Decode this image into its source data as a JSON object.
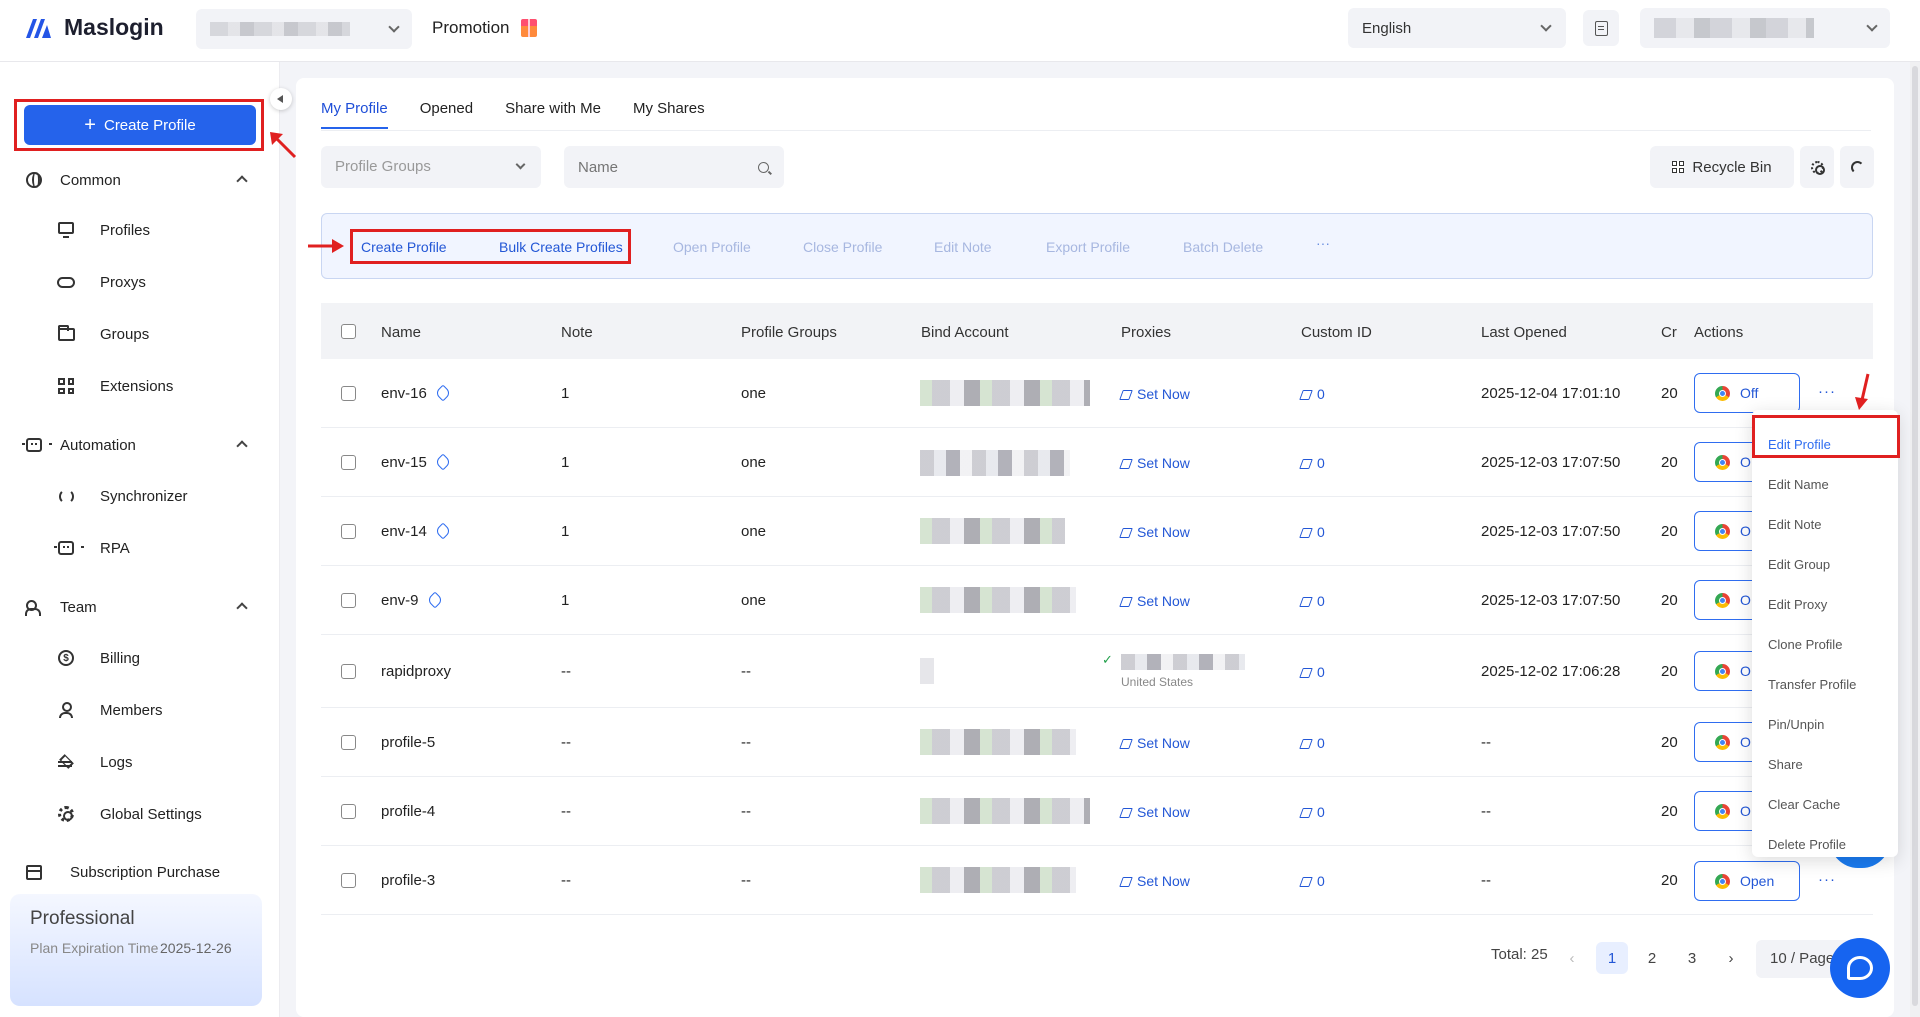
{
  "app": {
    "name": "Maslogin",
    "promotion": "Promotion",
    "language": "English"
  },
  "sidebar": {
    "create_profile": "Create Profile",
    "sections": [
      {
        "label": "Common",
        "items": [
          "Profiles",
          "Proxys",
          "Groups",
          "Extensions"
        ]
      },
      {
        "label": "Automation",
        "items": [
          "Synchronizer",
          "RPA"
        ]
      },
      {
        "label": "Team",
        "items": [
          "Billing",
          "Members",
          "Logs",
          "Global Settings"
        ]
      }
    ],
    "subscription": "Subscription Purchase",
    "plan": {
      "title": "Professional",
      "expiration_label": "Plan Expiration Time",
      "expiration_value": "2025-12-26"
    }
  },
  "tabs": [
    "My Profile",
    "Opened",
    "Share with Me",
    "My Shares"
  ],
  "filters": {
    "groups_placeholder": "Profile Groups",
    "name_placeholder": "Name",
    "recycle_bin": "Recycle Bin"
  },
  "actions": {
    "create_profile": "Create Profile",
    "bulk_create": "Bulk Create Profiles",
    "open_profile": "Open Profile",
    "close_profile": "Close Profile",
    "edit_note": "Edit Note",
    "export_profile": "Export Profile",
    "batch_delete": "Batch Delete",
    "more": "···"
  },
  "table": {
    "columns": [
      "Name",
      "Note",
      "Profile Groups",
      "Bind Account",
      "Proxies",
      "Custom ID",
      "Last Opened",
      "Cr",
      "Actions"
    ],
    "rows": [
      {
        "name": "env-16",
        "pinned": true,
        "note": "1",
        "group": "one",
        "proxy": "Set Now",
        "custom_id": "0",
        "last_opened": "2025-12-04 17:01:10",
        "created": "20",
        "action": "Off"
      },
      {
        "name": "env-15",
        "pinned": true,
        "note": "1",
        "group": "one",
        "proxy": "Set Now",
        "custom_id": "0",
        "last_opened": "2025-12-03 17:07:50",
        "created": "20",
        "action": "O"
      },
      {
        "name": "env-14",
        "pinned": true,
        "note": "1",
        "group": "one",
        "proxy": "Set Now",
        "custom_id": "0",
        "last_opened": "2025-12-03 17:07:50",
        "created": "20",
        "action": "O"
      },
      {
        "name": "env-9",
        "pinned": true,
        "note": "1",
        "group": "one",
        "proxy": "Set Now",
        "custom_id": "0",
        "last_opened": "2025-12-03 17:07:50",
        "created": "20",
        "action": "O"
      },
      {
        "name": "rapidproxy",
        "pinned": false,
        "note": "--",
        "group": "--",
        "proxy": "United States",
        "custom_id": "0",
        "last_opened": "2025-12-02 17:06:28",
        "created": "20",
        "action": "O"
      },
      {
        "name": "profile-5",
        "pinned": false,
        "note": "--",
        "group": "--",
        "proxy": "Set Now",
        "custom_id": "0",
        "last_opened": "--",
        "created": "20",
        "action": "O"
      },
      {
        "name": "profile-4",
        "pinned": false,
        "note": "--",
        "group": "--",
        "proxy": "Set Now",
        "custom_id": "0",
        "last_opened": "--",
        "created": "20",
        "action": "O"
      },
      {
        "name": "profile-3",
        "pinned": false,
        "note": "--",
        "group": "--",
        "proxy": "Set Now",
        "custom_id": "0",
        "last_opened": "--",
        "created": "20",
        "action": "Open"
      }
    ]
  },
  "context_menu": [
    "Edit Profile",
    "Edit Name",
    "Edit Note",
    "Edit Group",
    "Edit Proxy",
    "Clone Profile",
    "Transfer Profile",
    "Pin/Unpin",
    "Share",
    "Clear Cache",
    "Delete Profile"
  ],
  "pagination": {
    "total": "Total: 25",
    "pages": [
      "1",
      "2",
      "3"
    ],
    "current": "1",
    "page_size": "10 / Page",
    "prev": "‹",
    "next": "›"
  },
  "colors": {
    "primary": "#2563eb",
    "annotation": "#e02020"
  },
  "icons": {
    "proxy_ok": "check-icon"
  }
}
